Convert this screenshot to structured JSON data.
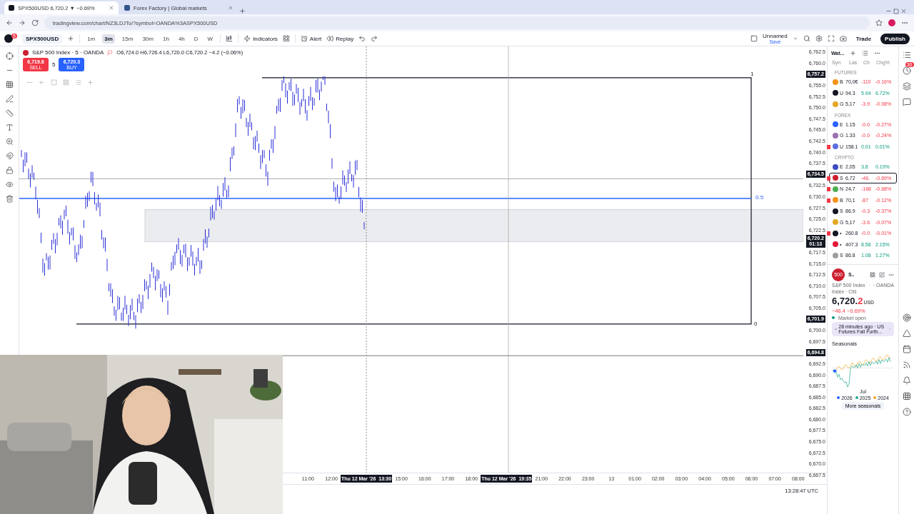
{
  "browser": {
    "tabs": [
      {
        "title": "SPX500USD 6,720.2 ▼ −0.69%",
        "selected": true
      },
      {
        "title": "Forex Factory | Global markets",
        "selected": false
      }
    ],
    "url": "tradingview.com/chart/NZ3LDJTo/?symbol=OANDA%3ASPX500USD"
  },
  "toolbar": {
    "badge": "5",
    "symbol": "SPX500USD",
    "intervals": [
      {
        "label": "1m",
        "selected": false
      },
      {
        "label": "3m",
        "selected": true
      },
      {
        "label": "15m",
        "selected": false
      },
      {
        "label": "30m",
        "selected": false
      },
      {
        "label": "1h",
        "selected": false
      },
      {
        "label": "4h",
        "selected": false
      },
      {
        "label": "D",
        "selected": false
      },
      {
        "label": "W",
        "selected": false
      }
    ],
    "indicators": "Indicators",
    "alert": "Alert",
    "replay": "Replay",
    "layout_name": "Unnamed",
    "layout_status": "Save",
    "trade": "Trade",
    "publish": "Publish"
  },
  "chart": {
    "title": "S&P 500 Index · 5 · OANDA",
    "ohlc": "O6,724.0 H6,726.4 L6,720.0 C6,720.2 −4.2 (−0.06%)",
    "sell": {
      "price": "6,719.8",
      "label": "SELL"
    },
    "spread": "5",
    "buy": {
      "price": "6,720.3",
      "label": "BUY"
    },
    "level_labels": [
      "1",
      "0.5",
      "0"
    ],
    "price_axis": [
      {
        "kind": "tick",
        "text": "6,762.5"
      },
      {
        "kind": "tick",
        "text": "6,760.0"
      },
      {
        "kind": "marker",
        "text": "6,757.2"
      },
      {
        "kind": "tick",
        "text": "6,755.0"
      },
      {
        "kind": "tick",
        "text": "6,752.5"
      },
      {
        "kind": "tick",
        "text": "6,750.0"
      },
      {
        "kind": "tick",
        "text": "6,747.5"
      },
      {
        "kind": "tick",
        "text": "6,745.0"
      },
      {
        "kind": "tick",
        "text": "6,742.5"
      },
      {
        "kind": "tick",
        "text": "6,740.0"
      },
      {
        "kind": "tick",
        "text": "6,737.5"
      },
      {
        "kind": "marker",
        "text": "6,734.5"
      },
      {
        "kind": "tick",
        "text": "6,732.5"
      },
      {
        "kind": "tick",
        "text": "6,730.0"
      },
      {
        "kind": "tick",
        "text": "6,727.5"
      },
      {
        "kind": "tick",
        "text": "6,725.0"
      },
      {
        "kind": "tick",
        "text": "6,722.5"
      },
      {
        "kind": "marker",
        "text": "6,720.2",
        "sub": "01:13"
      },
      {
        "kind": "tick",
        "text": "6,717.5"
      },
      {
        "kind": "tick",
        "text": "6,715.0"
      },
      {
        "kind": "tick",
        "text": "6,712.5"
      },
      {
        "kind": "tick",
        "text": "6,710.0"
      },
      {
        "kind": "tick",
        "text": "6,707.5"
      },
      {
        "kind": "tick",
        "text": "6,705.0"
      },
      {
        "kind": "marker",
        "text": "6,701.9"
      },
      {
        "kind": "tick",
        "text": "6,700.0"
      },
      {
        "kind": "tick",
        "text": "6,697.5"
      },
      {
        "kind": "marker",
        "text": "6,694.8"
      },
      {
        "kind": "tick",
        "text": "6,692.5"
      },
      {
        "kind": "tick",
        "text": "6,690.0"
      },
      {
        "kind": "tick",
        "text": "6,687.5"
      },
      {
        "kind": "tick",
        "text": "6,685.0"
      },
      {
        "kind": "tick",
        "text": "6,682.5"
      },
      {
        "kind": "tick",
        "text": "6,680.0"
      },
      {
        "kind": "tick",
        "text": "6,677.5"
      },
      {
        "kind": "tick",
        "text": "6,675.0"
      },
      {
        "kind": "tick",
        "text": "6,672.5"
      },
      {
        "kind": "tick",
        "text": "6,670.0"
      },
      {
        "kind": "tick",
        "text": "6,667.5"
      }
    ],
    "time_axis": [
      {
        "kind": "tick",
        "text": "11:00"
      },
      {
        "kind": "tick",
        "text": "12:00"
      },
      {
        "kind": "marker",
        "text": "Thu 12 Mar '26  13:30"
      },
      {
        "kind": "tick",
        "text": "15:00"
      },
      {
        "kind": "tick",
        "text": "16:00"
      },
      {
        "kind": "tick",
        "text": "17:00"
      },
      {
        "kind": "tick",
        "text": "18:00"
      },
      {
        "kind": "marker",
        "text": "Thu 12 Mar '26  19:35"
      },
      {
        "kind": "tick",
        "text": "21:00"
      },
      {
        "kind": "tick",
        "text": "22:00"
      },
      {
        "kind": "tick",
        "text": "23:00"
      },
      {
        "kind": "tick",
        "text": "13"
      },
      {
        "kind": "tick",
        "text": "01:00"
      },
      {
        "kind": "tick",
        "text": "02:00"
      },
      {
        "kind": "tick",
        "text": "03:00"
      },
      {
        "kind": "tick",
        "text": "04:00"
      },
      {
        "kind": "tick",
        "text": "05:00"
      },
      {
        "kind": "tick",
        "text": "06:00"
      },
      {
        "kind": "tick",
        "text": "07:00"
      },
      {
        "kind": "tick",
        "text": "08:00"
      }
    ],
    "clock": "13:28:47 UTC"
  },
  "watchlist": {
    "title": "Wat...",
    "columns": [
      "Syn",
      "Las",
      "Ch",
      "Chg%"
    ],
    "sections": [
      {
        "title": "FUTURES",
        "rows": [
          {
            "symbol": "B",
            "last": "70,0€",
            "change": "-110",
            "percent": "-0.16%",
            "negative": true,
            "color": "#f7931a",
            "flagged": false,
            "selected": false
          },
          {
            "symbol": "U",
            "last": "94.3",
            "change": "5.94",
            "percent": "6.72%",
            "negative": false,
            "color": "#131722",
            "flagged": false,
            "selected": false
          },
          {
            "symbol": "G",
            "last": "5,17",
            "change": "-3.9",
            "percent": "-0.08%",
            "negative": true,
            "color": "#e5a823",
            "flagged": false,
            "selected": false
          }
        ]
      },
      {
        "title": "FOREX",
        "rows": [
          {
            "symbol": "E",
            "last": "1.15",
            "change": "-0.0",
            "percent": "-0.27%",
            "negative": true,
            "color": "#2962ff",
            "flagged": false,
            "selected": false
          },
          {
            "symbol": "G",
            "last": "1.33",
            "change": "-0.0",
            "percent": "-0.24%",
            "negative": true,
            "color": "#9c6fb0",
            "flagged": false,
            "selected": false
          },
          {
            "symbol": "U",
            "last": "158.1",
            "change": "0.01",
            "percent": "0.01%",
            "negative": false,
            "color": "#5b6ee1",
            "flagged": true,
            "selected": false
          }
        ]
      },
      {
        "title": "CRYPTO",
        "rows": [
          {
            "symbol": "E",
            "last": "2,05",
            "change": "3.8",
            "percent": "0.19%",
            "negative": false,
            "color": "#3b4cc0",
            "flagged": false,
            "selected": false
          },
          {
            "symbol": "S",
            "last": "6,72",
            "change": "-46.",
            "percent": "-0.69%",
            "negative": true,
            "color": "#cc1f2f",
            "flagged": true,
            "selected": true
          },
          {
            "symbol": "N",
            "last": "24,7",
            "change": "-168",
            "percent": "-0.68%",
            "negative": true,
            "color": "#4caf50",
            "flagged": true,
            "selected": false
          },
          {
            "symbol": "B",
            "last": "70,1",
            "change": "-87",
            "percent": "-0.12%",
            "negative": true,
            "color": "#f7931a",
            "flagged": true,
            "selected": false
          },
          {
            "symbol": "S",
            "last": "86.9",
            "change": "-0.3",
            "percent": "-0.37%",
            "negative": true,
            "color": "#131722",
            "flagged": false,
            "selected": false
          },
          {
            "symbol": "G",
            "last": "5,17",
            "change": "-3.6",
            "percent": "-0.07%",
            "negative": true,
            "color": "#e5a823",
            "flagged": false,
            "selected": false
          },
          {
            "symbol": "•",
            "last": "260.8",
            "change": "-0.0",
            "percent": "-0.01%",
            "negative": true,
            "color": "#131722",
            "flagged": true,
            "selected": false
          },
          {
            "symbol": "•",
            "last": "407.3",
            "change": "8.58",
            "percent": "2.15%",
            "negative": false,
            "color": "#e31937",
            "flagged": false,
            "selected": false
          },
          {
            "symbol": "S",
            "last": "86.8",
            "change": "1.08",
            "percent": "1.27%",
            "negative": false,
            "color": "#9e9e9e",
            "flagged": false,
            "selected": false
          }
        ]
      }
    ]
  },
  "details": {
    "logo": "500",
    "symbol": "S..",
    "name": "S&P 500 Index",
    "exchange": "· OANDA",
    "type": "Index · Cfd",
    "price": "6,720.",
    "price_last": "2",
    "currency": "USD",
    "change": "−46.4  −0.69%",
    "status": "Market open",
    "news": "28 minutes ago · US Futures Fall Furth...",
    "seasonals": "Seasonals",
    "month": "Jul",
    "legend": [
      {
        "label": "2026",
        "color": "#2962ff"
      },
      {
        "label": "2025",
        "color": "#22ab94"
      },
      {
        "label": "2024",
        "color": "#f5a623"
      }
    ],
    "more": "More seasonals"
  },
  "side_badge": "30"
}
